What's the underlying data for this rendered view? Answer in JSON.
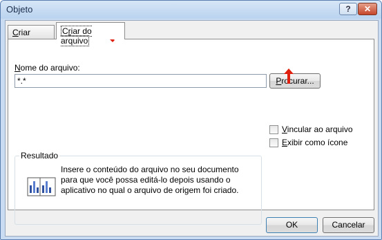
{
  "window": {
    "title": "Objeto"
  },
  "titlebar": {
    "help_label": "?",
    "close_label": "✕"
  },
  "tabs": [
    {
      "label": "Criar novo",
      "mnemonic": "C",
      "rest": "riar novo"
    },
    {
      "label": "Criar do arquivo",
      "mnemonic": "r",
      "pre": "C",
      "rest": "iar do arquivo"
    }
  ],
  "file_name": {
    "label": "Nome do arquivo:",
    "mnemonic": "N",
    "rest": "ome do arquivo:",
    "value": "*.*"
  },
  "browse_button": {
    "label": "Procurar...",
    "mnemonic": "P",
    "rest": "rocurar..."
  },
  "options": [
    {
      "label": "Vincular ao arquivo",
      "mnemonic": "V",
      "rest": "incular ao arquivo",
      "checked": false
    },
    {
      "label": "Exibir como ícone",
      "mnemonic": "E",
      "rest": "xibir como ícone",
      "checked": false
    }
  ],
  "result": {
    "title": "Resultado",
    "text": "Insere o conteúdo do arquivo no seu documento para que você possa editá-lo depois usando o aplicativo no qual o arquivo de origem foi criado."
  },
  "footer": {
    "ok_label": "OK",
    "cancel_label": "Cancelar"
  },
  "colors": {
    "annotation_arrow": "#e0200f",
    "window_frame": "#c9dcf1",
    "close_button": "#c5462b"
  }
}
